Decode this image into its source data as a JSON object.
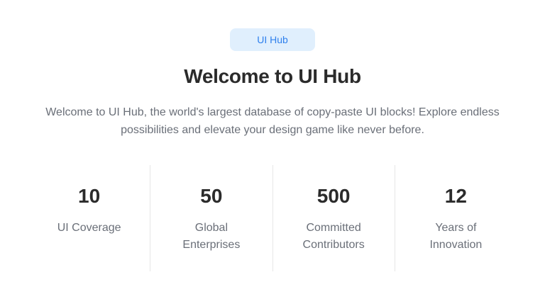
{
  "badge": {
    "label": "UI Hub"
  },
  "header": {
    "title": "Welcome to UI Hub",
    "subtitle": "Welcome to UI Hub, the world's largest database of copy-paste UI blocks! Explore endless possibilities and elevate your design game like never before."
  },
  "stats": [
    {
      "value": "10",
      "label": "UI Coverage"
    },
    {
      "value": "50",
      "label": "Global Enterprises"
    },
    {
      "value": "500",
      "label": "Committed Contributors"
    },
    {
      "value": "12",
      "label": "Years of Innovation"
    }
  ],
  "colors": {
    "accent": "#2f80ed",
    "badge_bg": "#e0effd",
    "heading": "#2b2b2b",
    "body_text": "#6a6f78",
    "divider": "#e6e6e6"
  }
}
